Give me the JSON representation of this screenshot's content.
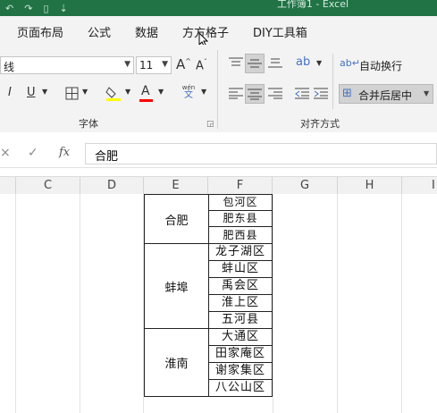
{
  "window": {
    "title": "工作簿1 - Excel"
  },
  "ribbon_tabs": [
    "页面布局",
    "公式",
    "数据",
    "方方格子",
    "DIY工具箱"
  ],
  "font_group": {
    "font_name": "线",
    "font_size": "11",
    "label": "字体",
    "bold": "B",
    "italic": "I",
    "underline": "U",
    "grow": "A",
    "shrink": "A",
    "font_color_glyph": "A",
    "phonetic": "wén"
  },
  "align_group": {
    "wrap_text": "自动换行",
    "merge_center": "合并后居中",
    "label": "对齐方式"
  },
  "formula_bar": {
    "fx": "fx",
    "content": "合肥"
  },
  "columns": [
    "C",
    "D",
    "E",
    "F",
    "G",
    "H",
    "I"
  ],
  "table": [
    {
      "city": "合肥",
      "districts": [
        "包河区",
        "肥东县",
        "肥西县"
      ]
    },
    {
      "city": "蚌埠",
      "districts": [
        "龙子湖区",
        "蚌山区",
        "禹会区",
        "淮上区",
        "五河县"
      ]
    },
    {
      "city": "淮南",
      "districts": [
        "大通区",
        "田家庵区",
        "谢家集区",
        "八公山区"
      ]
    }
  ],
  "colors": {
    "titlebar": "#217346",
    "ribbon": "#f3f3f3",
    "highlight_yellow": "#ffff00",
    "font_red": "#ff0000"
  }
}
